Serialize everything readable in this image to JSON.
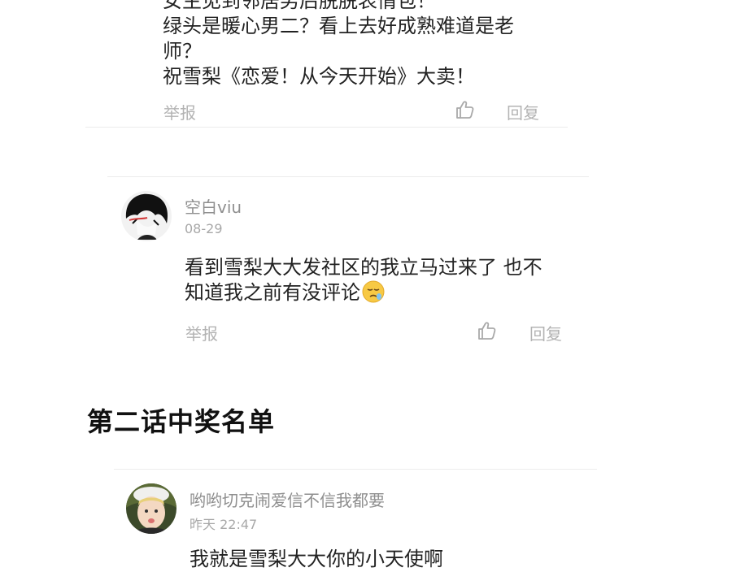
{
  "comments": [
    {
      "lines": [
        "女主见到邻居男后脱脱表情包！",
        "绿头是暖心男二？看上去好成熟难道是老",
        "师？",
        "祝雪梨《恋爱！从今天开始》大卖！"
      ],
      "report_label": "举报",
      "reply_label": "回复"
    },
    {
      "username": "空白viu",
      "timestamp": "08-29",
      "lines": [
        "看到雪梨大大发社区的我立马过来了 也不",
        "知道我之前有没评论"
      ],
      "emoji_icon": "sleepy-face-icon",
      "report_label": "举报",
      "reply_label": "回复"
    }
  ],
  "section_title": "第二话中奖名单",
  "winner_comment": {
    "username": "哟哟切克闹爱信不信我都要",
    "timestamp": "昨天 22:47",
    "text": "我就是雪梨大大你的小天使啊"
  },
  "icons": {
    "like": "thumbs-up-icon"
  }
}
